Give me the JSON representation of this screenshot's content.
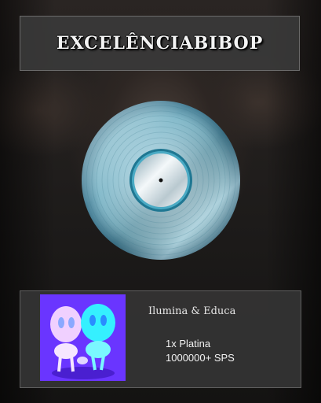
{
  "header": {
    "title": "EXCELÊNCIABIBOP"
  },
  "award": {
    "disc_icon": "platinum-record-disc",
    "artist": "Ilumina & Educa",
    "certification": "1x Platina",
    "units": "1000000+ SPS",
    "cover_colors": {
      "background": "#6a35ff",
      "left_figure": "#f0d0ff",
      "right_figure": "#35f0ff"
    }
  }
}
